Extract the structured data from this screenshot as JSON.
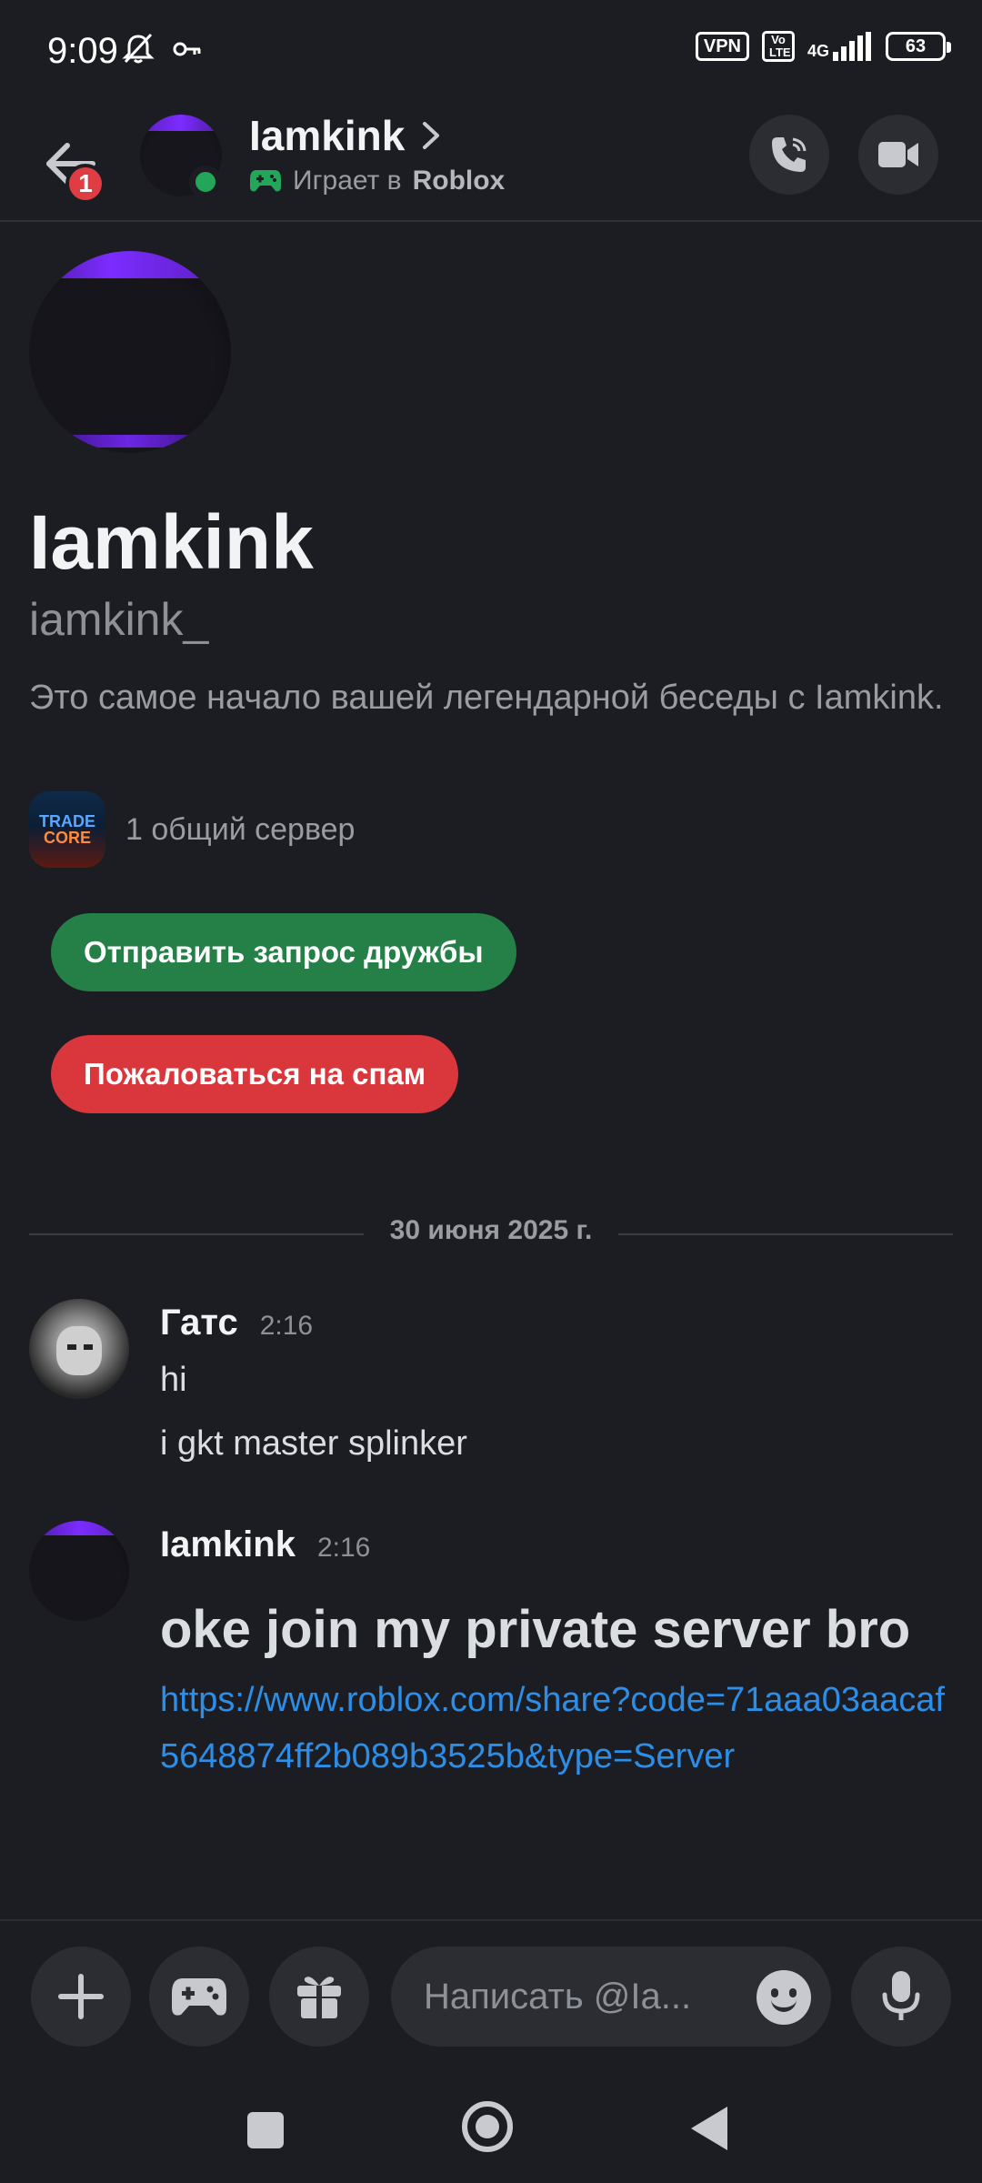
{
  "status_bar": {
    "time": "9:09",
    "vpn": "VPN",
    "volte": "Vo LTE",
    "network": "4G",
    "battery": "63"
  },
  "header": {
    "name": "Iamkink",
    "activity_prefix": "Играет в",
    "activity_game": "Roblox",
    "back_badge": "1"
  },
  "intro": {
    "display_name": "Iamkink",
    "username": "iamkink_",
    "description": "Это самое начало вашей легендарной беседы с Iamkink.",
    "mutual_servers": "1 общий сервер",
    "server_icon_text_1": "TRADE",
    "server_icon_text_2": "CORE"
  },
  "buttons": {
    "friend_request": "Отправить запрос дружбы",
    "report_spam": "Пожаловаться на спам"
  },
  "date_divider": "30 июня 2025 г.",
  "messages": [
    {
      "author": "Гатс",
      "time": "2:16",
      "lines": [
        "hi",
        "i gkt master splinker"
      ]
    },
    {
      "author": "Iamkink",
      "time": "2:16",
      "big_text": "oke join my private server bro",
      "link": "https://www.roblox.com/share?code=71aaa03aacaf5648874ff2b089b3525b&type=Server"
    }
  ],
  "composer": {
    "placeholder": "Написать @Ia..."
  },
  "colors": {
    "background": "#1c1d22",
    "online": "#23a55a",
    "friend_button": "#248046",
    "spam_button": "#da373c",
    "link": "#2d8ee8",
    "badge": "#e03c43"
  },
  "icons": {
    "back": "arrow-left-icon",
    "call": "phone-icon",
    "video": "video-camera-icon",
    "add": "plus-icon",
    "games": "gamepad-icon",
    "gift": "gift-icon",
    "emoji": "emoji-icon",
    "mic": "microphone-icon"
  }
}
